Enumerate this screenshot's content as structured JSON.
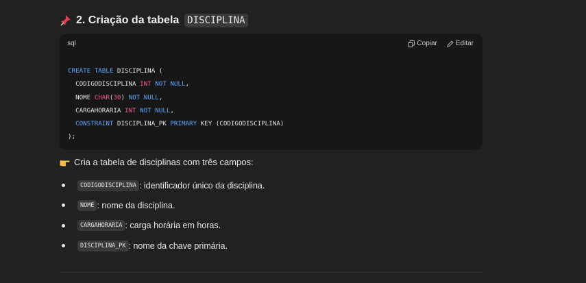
{
  "heading": {
    "number_title": "2. Criação da tabela",
    "table_name": "DISCIPLINA"
  },
  "code_block": {
    "language": "sql",
    "copy_label": "Copiar",
    "edit_label": "Editar",
    "lines": [
      [
        {
          "t": "CREATE TABLE",
          "c": "kw"
        },
        {
          "t": " DISCIPLINA (",
          "c": "pl"
        }
      ],
      [
        {
          "t": "  CODIGODISCIPLINA ",
          "c": "pl"
        },
        {
          "t": "INT",
          "c": "ty"
        },
        {
          "t": " ",
          "c": "pl"
        },
        {
          "t": "NOT NULL",
          "c": "kw"
        },
        {
          "t": ",",
          "c": "pl"
        }
      ],
      [
        {
          "t": "  NOME ",
          "c": "pl"
        },
        {
          "t": "CHAR",
          "c": "ty"
        },
        {
          "t": "(",
          "c": "pl"
        },
        {
          "t": "30",
          "c": "num"
        },
        {
          "t": ") ",
          "c": "pl"
        },
        {
          "t": "NOT NULL",
          "c": "kw"
        },
        {
          "t": ",",
          "c": "pl"
        }
      ],
      [
        {
          "t": "  CARGAHORARIA ",
          "c": "pl"
        },
        {
          "t": "INT",
          "c": "ty"
        },
        {
          "t": " ",
          "c": "pl"
        },
        {
          "t": "NOT NULL",
          "c": "kw"
        },
        {
          "t": ",",
          "c": "pl"
        }
      ],
      [
        {
          "t": "  CONSTRAINT",
          "c": "kw"
        },
        {
          "t": " DISCIPLINA_PK ",
          "c": "pl"
        },
        {
          "t": "PRIMARY",
          "c": "kw"
        },
        {
          "t": " KEY (CODIGODISCIPLINA)",
          "c": "pl"
        }
      ],
      [
        {
          "t": ");",
          "c": "pl"
        }
      ]
    ]
  },
  "intro_text": "Cria a tabela de disciplinas com três campos:",
  "fields": [
    {
      "code": "CODIGODISCIPLINA",
      "desc": ": identificador único da disciplina."
    },
    {
      "code": "NOME",
      "desc": ": nome da disciplina."
    },
    {
      "code": "CARGAHORARIA",
      "desc": ": carga horária em horas."
    },
    {
      "code": "DISCIPLINA_PK",
      "desc": ": nome da chave primária."
    }
  ],
  "colors": {
    "background": "#212121",
    "code_background": "#171717",
    "keyword": "#5ea7ff",
    "type": "#f05a8a"
  },
  "icons": {
    "heading": "pushpin-icon",
    "intro": "pointing-hand-icon",
    "copy": "copy-icon",
    "edit": "edit-icon"
  }
}
